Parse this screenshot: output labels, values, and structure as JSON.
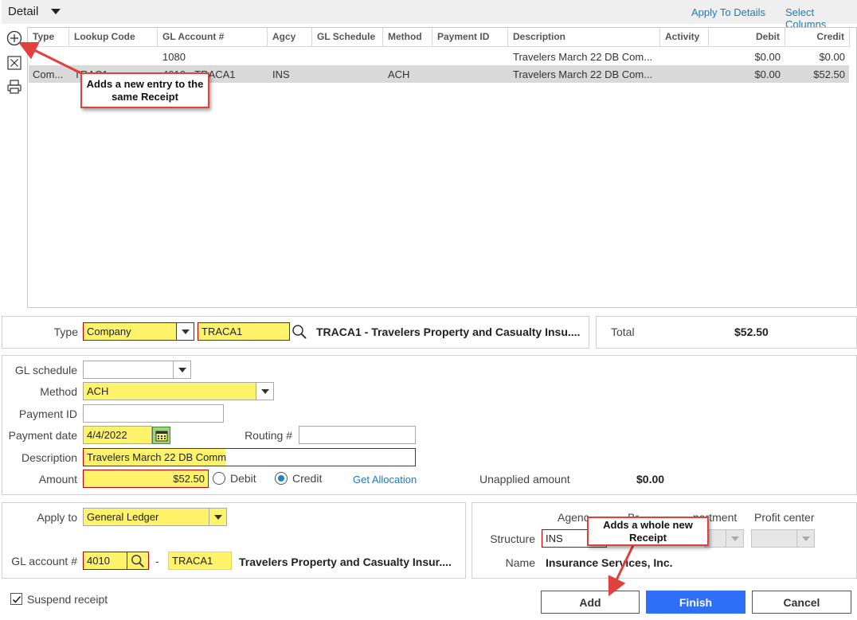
{
  "header": {
    "title": "Detail",
    "apply_to_details": "Apply To Details",
    "select_columns": "Select Columns"
  },
  "grid": {
    "columns": [
      "Type",
      "Lookup Code",
      "GL Account #",
      "Agcy",
      "GL Schedule",
      "Method",
      "Payment ID",
      "Description",
      "Activity",
      "Debit",
      "Credit"
    ],
    "rows": [
      {
        "type": "",
        "lookup": "",
        "gl_account": "1080",
        "agcy": "",
        "gl_schedule": "",
        "method": "",
        "payment_id": "",
        "description": "Travelers March 22 DB Com...",
        "activity": "",
        "debit": "$0.00",
        "credit": "$0.00"
      },
      {
        "type": "Com...",
        "lookup": "TRAC1",
        "gl_account": "4010 - TRACA1",
        "agcy": "INS",
        "gl_schedule": "",
        "method": "ACH",
        "payment_id": "",
        "description": "Travelers March 22 DB Com...",
        "activity": "",
        "debit": "$0.00",
        "credit": "$52.50"
      }
    ]
  },
  "icons": {
    "add": "plus-circle-icon",
    "delete": "close-box-icon",
    "print": "printer-icon"
  },
  "type_panel": {
    "label": "Type",
    "type_value": "Company",
    "code_value": "TRACA1",
    "company_name": "TRACA1 - Travelers Property and Casualty Insu...."
  },
  "total_panel": {
    "label": "Total",
    "value": "$52.50"
  },
  "form": {
    "gl_schedule_label": "GL schedule",
    "gl_schedule_value": "",
    "method_label": "Method",
    "method_value": "ACH",
    "payment_id_label": "Payment ID",
    "payment_id_value": "",
    "payment_date_label": "Payment date",
    "payment_date_value": "4/4/2022",
    "routing_label": "Routing #",
    "routing_value": "",
    "description_label": "Description",
    "description_value": "Travelers March 22 DB Comm",
    "amount_label": "Amount",
    "amount_value": "$52.50",
    "debit_label": "Debit",
    "credit_label": "Credit",
    "selected": "Credit",
    "get_allocation": "Get Allocation",
    "unapplied_label": "Unapplied amount",
    "unapplied_value": "$0.00"
  },
  "apply_panel": {
    "apply_to_label": "Apply to",
    "apply_to_value": "General Ledger",
    "gl_account_label": "GL account #",
    "gl_account_value": "4010",
    "dash": "-",
    "gl_sub_value": "TRACA1",
    "gl_name": "Travelers Property and Casualty Insur...."
  },
  "structure_panel": {
    "col_agency": "Agenc",
    "col_branch": "Br",
    "col_department": "partment",
    "col_profit_center": "Profit center",
    "structure_label": "Structure",
    "structure_value": "INS",
    "name_label": "Name",
    "name_value": "Insurance Services, Inc."
  },
  "footer": {
    "suspend_label": "Suspend receipt",
    "suspend_checked": true,
    "add": "Add",
    "finish": "Finish",
    "cancel": "Cancel"
  },
  "callouts": {
    "top": "Adds a new entry to the same Receipt",
    "bottom": "Adds a whole new Receipt"
  },
  "colors": {
    "highlight": "#fff36b",
    "required_border": "#c00000",
    "primary": "#2f6ef7",
    "link": "#1f7ab8",
    "callout_border": "#e0413d"
  }
}
